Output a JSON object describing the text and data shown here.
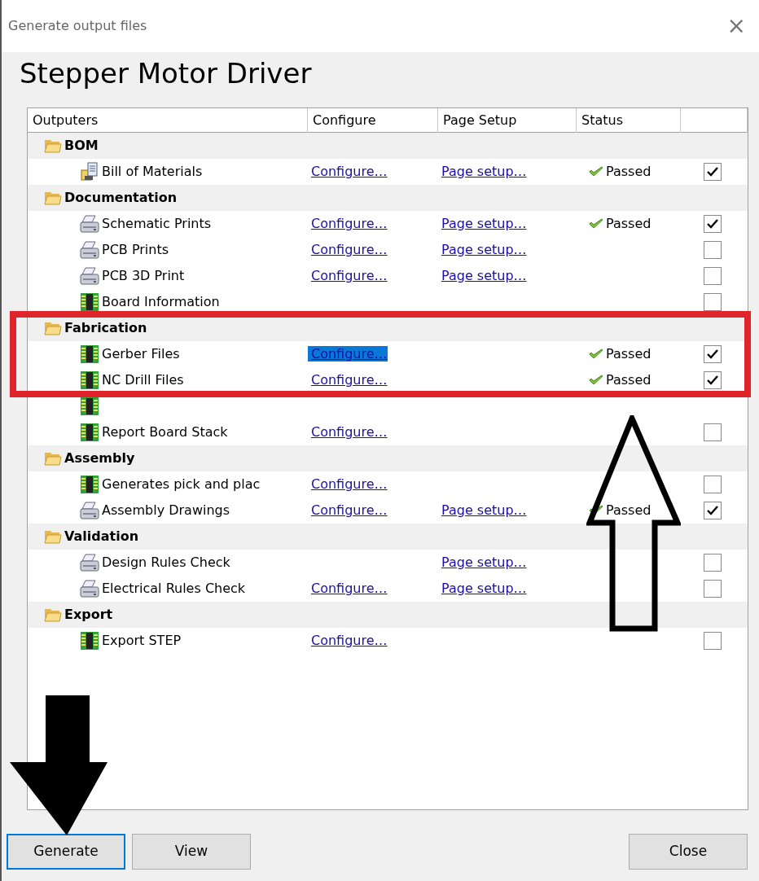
{
  "window": {
    "title": "Generate output files",
    "close": "×"
  },
  "heading": "Stepper Motor Driver",
  "table": {
    "columns": [
      "Outputers",
      "Configure",
      "Page Setup",
      "Status"
    ],
    "groups": [
      {
        "name": "BOM",
        "items": [
          {
            "name": "Bill of Materials",
            "kind": "bom",
            "configure": "Configure…",
            "configure_selected": false,
            "page_setup": "Page setup…",
            "status": "Passed",
            "checked": true
          }
        ]
      },
      {
        "name": "Documentation",
        "items": [
          {
            "name": "Schematic Prints",
            "kind": "printer",
            "configure": "Configure…",
            "configure_selected": false,
            "page_setup": "Page setup…",
            "status": "Passed",
            "checked": true
          },
          {
            "name": "PCB Prints",
            "kind": "printer",
            "configure": "Configure…",
            "configure_selected": false,
            "page_setup": "Page setup…",
            "checked": false
          },
          {
            "name": "PCB 3D Print",
            "kind": "printer",
            "configure": "Configure…",
            "configure_selected": false,
            "page_setup": "Page setup…",
            "checked": false
          },
          {
            "name": "Board Information",
            "kind": "board",
            "checked": false
          }
        ]
      },
      {
        "name": "Fabrication",
        "items": [
          {
            "name": "Gerber Files",
            "kind": "board",
            "configure": "Configure…",
            "configure_selected": true,
            "status": "Passed",
            "checked": true
          },
          {
            "name": "NC Drill Files",
            "kind": "board",
            "configure": "Configure…",
            "configure_selected": false,
            "status": "Passed",
            "checked": true
          },
          {
            "kind": "board"
          },
          {
            "name": "Report Board Stack",
            "kind": "board",
            "configure": "Configure…",
            "configure_selected": false,
            "checked": false
          }
        ]
      },
      {
        "name": "Assembly",
        "items": [
          {
            "name": "Generates pick and plac",
            "kind": "board",
            "configure": "Configure…",
            "configure_selected": false,
            "checked": false
          },
          {
            "name": "Assembly Drawings",
            "kind": "printer",
            "configure": "Configure…",
            "configure_selected": false,
            "page_setup": "Page setup…",
            "status": "Passed",
            "checked": true
          }
        ]
      },
      {
        "name": "Validation",
        "items": [
          {
            "name": "Design Rules Check",
            "kind": "printer",
            "page_setup": "Page setup…",
            "checked": false
          },
          {
            "name": "Electrical Rules Check",
            "kind": "printer",
            "configure": "Configure…",
            "configure_selected": false,
            "page_setup": "Page setup…",
            "checked": false
          }
        ]
      },
      {
        "name": "Export",
        "items": [
          {
            "name": "Export STEP",
            "kind": "board",
            "configure": "Configure…",
            "configure_selected": false,
            "checked": false
          }
        ]
      }
    ]
  },
  "buttons": [
    {
      "label": "Generate",
      "focused": true
    },
    {
      "label": "View",
      "focused": false
    },
    {
      "label": "Close",
      "focused": false
    }
  ],
  "annotations": [
    {
      "kind": "highlight-box"
    },
    {
      "kind": "up-arrow"
    },
    {
      "kind": "down-arrow"
    }
  ]
}
